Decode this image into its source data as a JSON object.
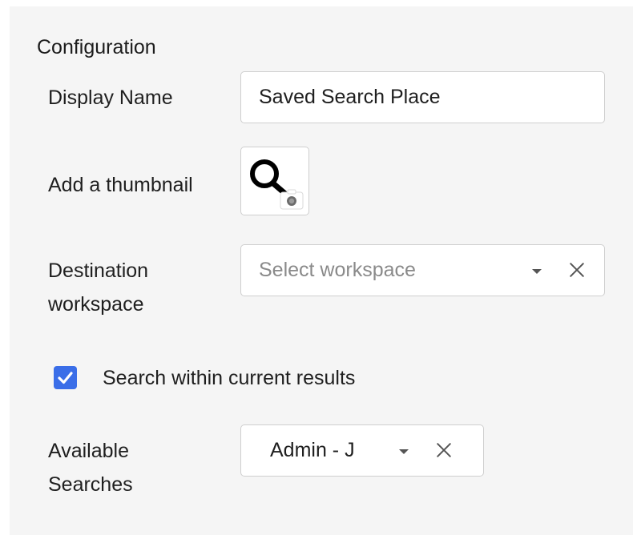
{
  "form": {
    "heading": "Configuration",
    "display_name": {
      "label": "Display Name",
      "value": "Saved Search Place"
    },
    "thumbnail": {
      "label": "Add a thumbnail",
      "icon": "magnifier-thumbnail-icon",
      "overlay_icon": "camera-icon"
    },
    "destination": {
      "label_line1": "Destination",
      "label_line2": "workspace",
      "placeholder": "Select workspace"
    },
    "search_within": {
      "label": "Search within current results",
      "checked": true
    },
    "available_searches": {
      "label_line1": "Available",
      "label_line2": "Searches",
      "selected": "Admin - J"
    }
  },
  "colors": {
    "panel_bg": "#f5f5f5",
    "checkbox_accent": "#3a6ee8",
    "field_border": "#cfcfcf"
  }
}
